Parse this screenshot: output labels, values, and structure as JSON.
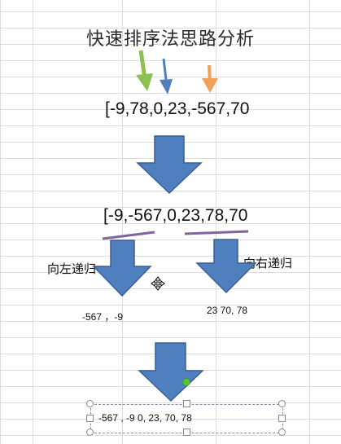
{
  "title": "快速排序法思路分析",
  "array_initial": "[-9,78,0,23,-567,70",
  "array_partitioned": "[-9,-567,0,23,78,70",
  "left_label": "向左递归",
  "right_label": "向右递归",
  "left_result": "-567 ，-9",
  "right_result": "23 70, 78",
  "final_result": "-567 , -9  0, 23, 70, 78",
  "colors": {
    "arrow_blue": "#4f7fbe",
    "arrow_green": "#8cc051",
    "arrow_orange": "#f2a05a",
    "underline_purple": "#8064a2",
    "handle_green": "#55c43e"
  },
  "icons": {
    "cursor": "move-cursor-icon"
  }
}
